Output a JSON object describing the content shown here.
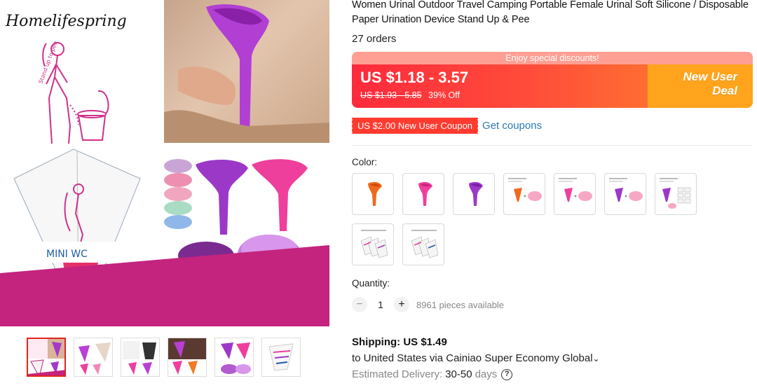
{
  "product": {
    "brand_watermark": "Homelifespring",
    "title": "Women Urinal Outdoor Travel Camping Portable Female Urinal Soft Silicone / Disposable Paper Urination Device Stand Up & Pee",
    "orders": "27 orders"
  },
  "price": {
    "discount_strip": "Enjoy special discounts!",
    "current": "US $1.18 - 3.57",
    "original": "US $1.93 - 5.85",
    "off": "39% Off",
    "deal_line1": "New User",
    "deal_line2": "Deal"
  },
  "coupon": {
    "tag": "US $2.00 New User Coupon",
    "link": "Get coupons"
  },
  "options": {
    "color_label": "Color:",
    "swatches": [
      {
        "icon": "orange-urinal-icon"
      },
      {
        "icon": "pink-urinal-icon"
      },
      {
        "icon": "purple-urinal-icon"
      },
      {
        "icon": "orange-urinal-case-icon"
      },
      {
        "icon": "pink-urinal-case-icon"
      },
      {
        "icon": "purple-urinal-case-icon"
      },
      {
        "icon": "purple-urinal-papers-icon"
      },
      {
        "icon": "paper-urinals-pack-icon"
      },
      {
        "icon": "paper-urinals-pack-icon"
      }
    ]
  },
  "quantity": {
    "label": "Quantity:",
    "minus": "−",
    "value": "1",
    "plus": "+",
    "available": "8961 pieces available"
  },
  "shipping": {
    "label": "Shipping: US $1.49",
    "via": "to United States via Cainiao Super Economy Global",
    "chevron": "⌄",
    "delivery_label": "Estimated Delivery:",
    "delivery_days": "30-50",
    "delivery_unit": "days",
    "help": "?"
  },
  "colors": {
    "accent_red": "#ff2a3c",
    "deal_orange": "#ffa41c",
    "link_blue": "#2a7ab8",
    "magenta": "#c4237e"
  }
}
